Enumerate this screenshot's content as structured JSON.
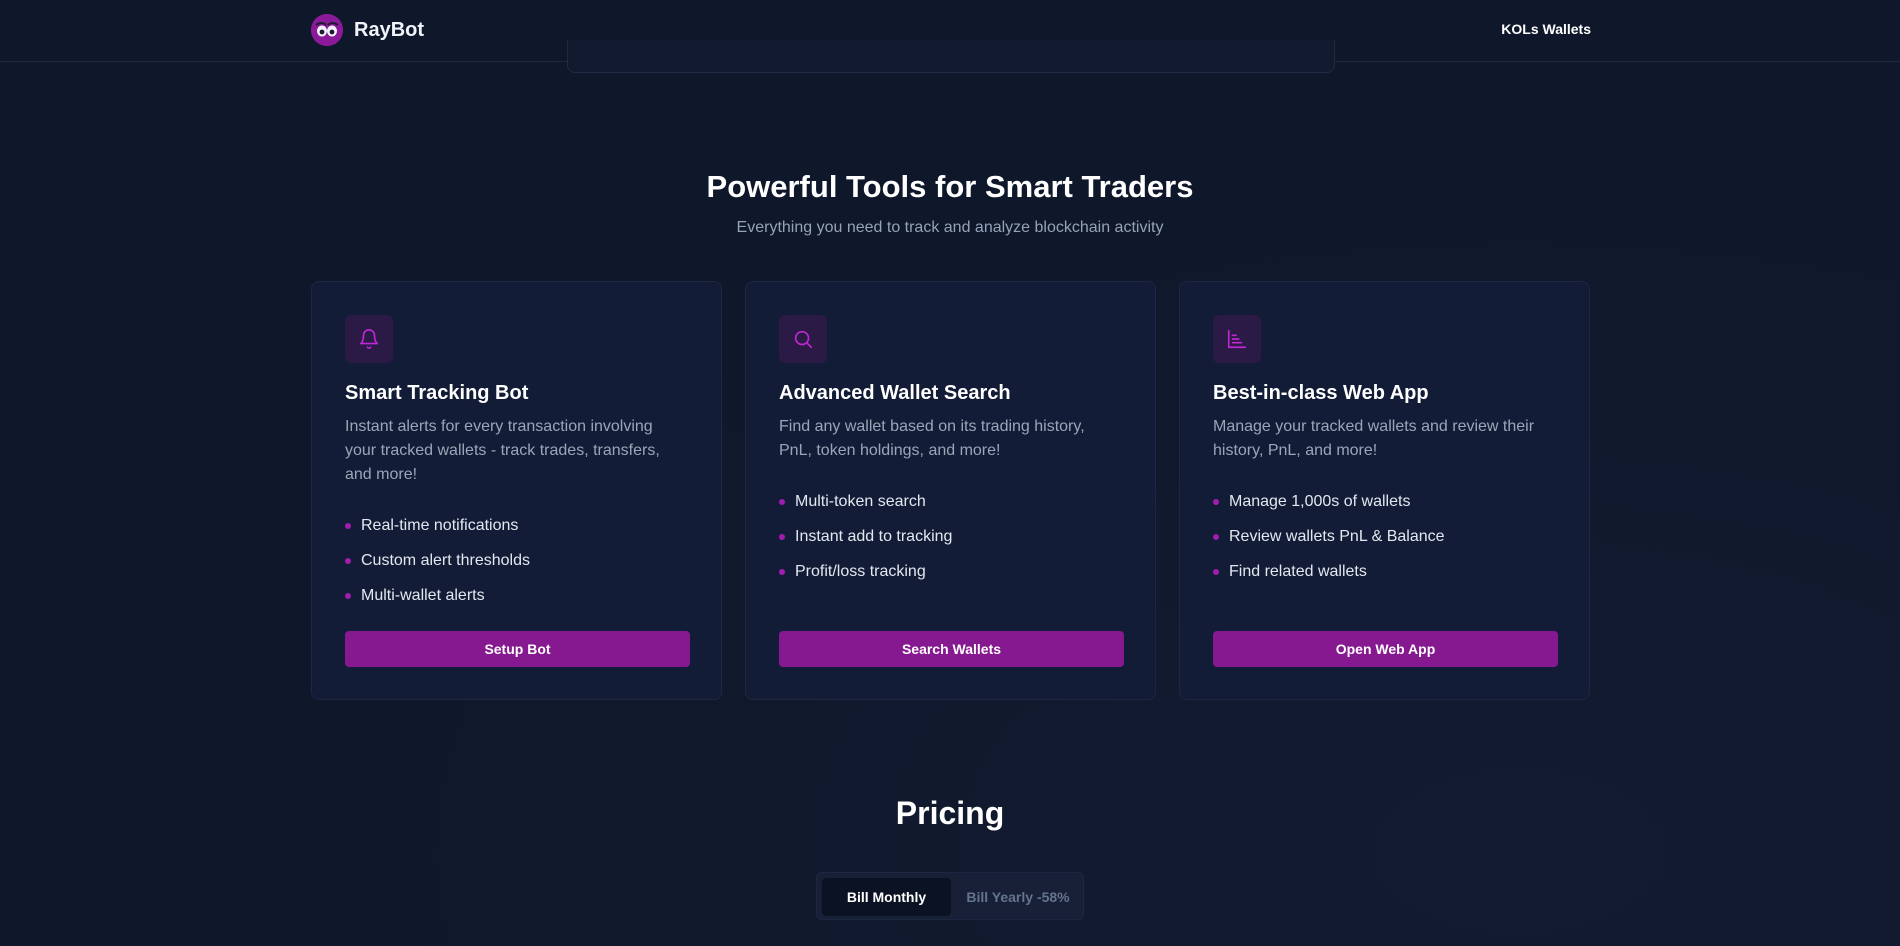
{
  "header": {
    "brand_name": "RayBot",
    "nav_link": "KOLs Wallets"
  },
  "features": {
    "title": "Powerful Tools for Smart Traders",
    "subtitle": "Everything you need to track and analyze blockchain activity",
    "cards": [
      {
        "icon": "bell-icon",
        "title": "Smart Tracking Bot",
        "description": "Instant alerts for every transaction involving your tracked wallets - track trades, transfers, and more!",
        "items": [
          "Real-time notifications",
          "Custom alert thresholds",
          "Multi-wallet alerts"
        ],
        "button": "Setup Bot"
      },
      {
        "icon": "search-icon",
        "title": "Advanced Wallet Search",
        "description": "Find any wallet based on its trading history, PnL, token holdings, and more!",
        "items": [
          "Multi-token search",
          "Instant add to tracking",
          "Profit/loss tracking"
        ],
        "button": "Search Wallets"
      },
      {
        "icon": "bar-chart-icon",
        "title": "Best-in-class Web App",
        "description": "Manage your tracked wallets and review their history, PnL, and more!",
        "items": [
          "Manage 1,000s of wallets",
          "Review wallets PnL & Balance",
          "Find related wallets"
        ],
        "button": "Open Web App"
      }
    ]
  },
  "pricing": {
    "title": "Pricing",
    "billing_options": [
      "Bill Monthly",
      "Bill Yearly -58%"
    ],
    "selected": "Bill Monthly"
  },
  "colors": {
    "background": "#0f172a",
    "card_bg": "#131c36",
    "accent": "#86198f",
    "icon_accent": "#c026d3"
  }
}
